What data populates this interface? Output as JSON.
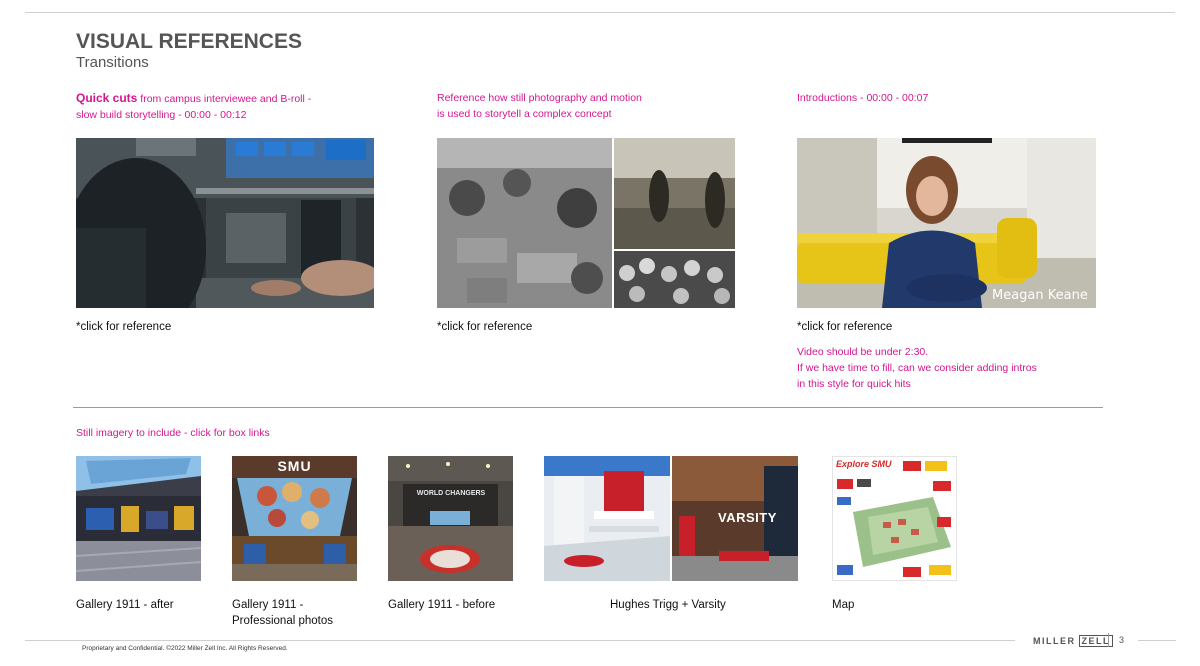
{
  "header": {
    "title": "VISUAL REFERENCES",
    "subtitle": "Transitions"
  },
  "references": [
    {
      "heading_bold": "Quick cuts",
      "heading_rest": " from campus interviewee and B-roll -",
      "heading_line2": "slow build storytelling - 00:00 - 00:12",
      "caption": "*click for reference"
    },
    {
      "heading_line1": "Reference how still photography and motion",
      "heading_line2": "is used to storytell a complex concept",
      "caption": "*click for reference"
    },
    {
      "heading_line1": "Introductions - 00:00 - 00:07",
      "caption": "*click for reference",
      "overlay_name": "Meagan Keane",
      "note_lines": [
        "Video should be under 2:30.",
        "If we have time to fill, can we consider adding intros",
        "in this style for quick hits"
      ]
    }
  ],
  "still_imagery": {
    "heading": "Still imagery to include - click for box links",
    "items": [
      {
        "label_line1": "Gallery 1911 - after"
      },
      {
        "label_line1": "Gallery 1911 -",
        "label_line2": "Professional photos",
        "sign": "SMU"
      },
      {
        "label_line1": "Gallery 1911 - before",
        "sign": "WORLD CHANGERS"
      },
      {
        "label_line1": "Hughes Trigg + Varsity",
        "sign": "VARSITY"
      },
      {
        "label_line1": "Map",
        "sign": "Explore SMU"
      }
    ]
  },
  "footer": {
    "legal": "Proprietary and Confidential. ©2022 Miller Zell Inc. All Rights Reserved.",
    "logo_left": "MILLER",
    "logo_right": "ZELL",
    "page": "3"
  },
  "colors": {
    "accent": "#d4168f",
    "title": "#555555"
  }
}
